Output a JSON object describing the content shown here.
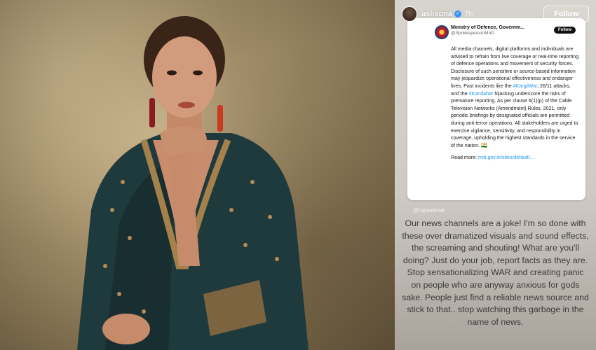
{
  "story": {
    "username": "aslisona",
    "verified_icon": "verified-badge-icon",
    "time": "7h",
    "follow_label": "Follow",
    "reply_handle": "@rajasekhar",
    "caption": "Our news channels are a joke! I'm so done with these over dramatized visuals and sound effects, the screaming and shouting! What are you'll doing? Just do your job, report facts as they are. Stop sensationalizing WAR and creating panic on people who are anyway anxious for gods sake. People just find a reliable news source and stick to that.. stop watching this garbage in the name of news."
  },
  "tweet": {
    "name": "Ministry of Defence, Governm...",
    "handle": "@SpokespersonMoD",
    "follow_label": "Follow",
    "body_part1": "All media channels, digital platforms and individuals are advised to refrain from live coverage or real-time reporting of defence operations and movement of security forces. Disclosure of such sensitive or source-based information may jeopardize operational effectiveness and endanger lives. Past incidents like the ",
    "tag1": "#KargilWar",
    "body_part2": ", 26/11 attacks, and the ",
    "tag2": "#Kandahar",
    "body_part3": " hijacking underscore the risks of premature reporting. As per clause 6(1)(p) of the Cable Television Networks (Amendment) Rules, 2021, only periodic briefings by designated officials are permitted during anti-terror operations. All stakeholders are urged to exercise vigilance, sensitivity, and responsibility in coverage, upholding the highest standards in the service of the nation. 🇮🇳",
    "read_more_label": "Read more: ",
    "read_more_link": "mib.gov.in/sites/default/..."
  },
  "colors": {
    "link": "#1d9bf0",
    "verified": "#3b93f7",
    "velvet": "#1f3a3c"
  }
}
